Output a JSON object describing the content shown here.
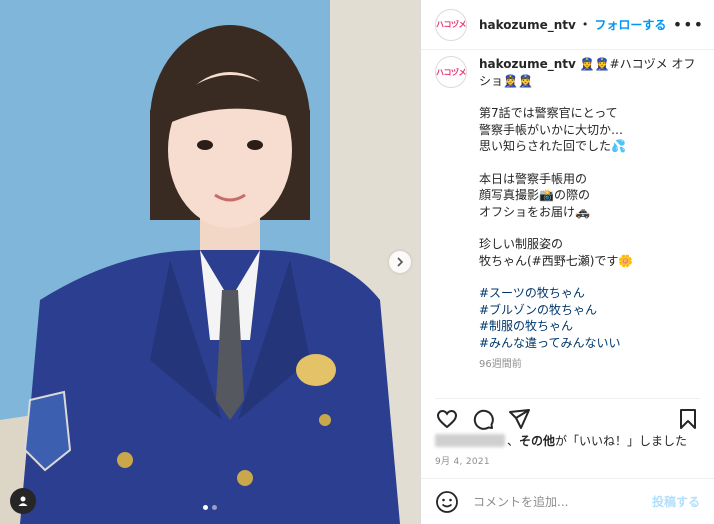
{
  "header": {
    "avatar_text": "ハコヅメ",
    "username": "hakozume_ntv",
    "dot": "•",
    "follow_label": "フォローする",
    "more_label": "•••"
  },
  "caption": {
    "username": "hakozume_ntv",
    "lines": [
      "👮‍♀️👮‍♀️#ハコヅメ オフ",
      "ショ👮‍♀️👮‍♀️",
      "",
      "第7話では警察官にとって",
      "警察手帳がいかに大切か…",
      "思い知らされた回でした💦",
      "",
      "本日は警察手帳用の",
      "顔写真撮影📸の際の",
      "オフショをお届け🚓",
      "",
      "珍しい制服姿の",
      "牧ちゃん(#西野七瀬)です🌼",
      "",
      "#スーツの牧ちゃん",
      "#ブルゾンの牧ちゃん",
      "#制服の牧ちゃん",
      "#みんな違ってみんないい"
    ],
    "time": "96週間前"
  },
  "likes": {
    "text_a": "、",
    "bold": "その他",
    "text_b": "が「いいね！」しました"
  },
  "date": "9月 4, 2021",
  "comment": {
    "placeholder": "コメントを追加...",
    "post_label": "投稿する"
  },
  "colors": {
    "accent": "#0095f6",
    "hashtag": "#00376b",
    "brand": "#e8336f"
  }
}
